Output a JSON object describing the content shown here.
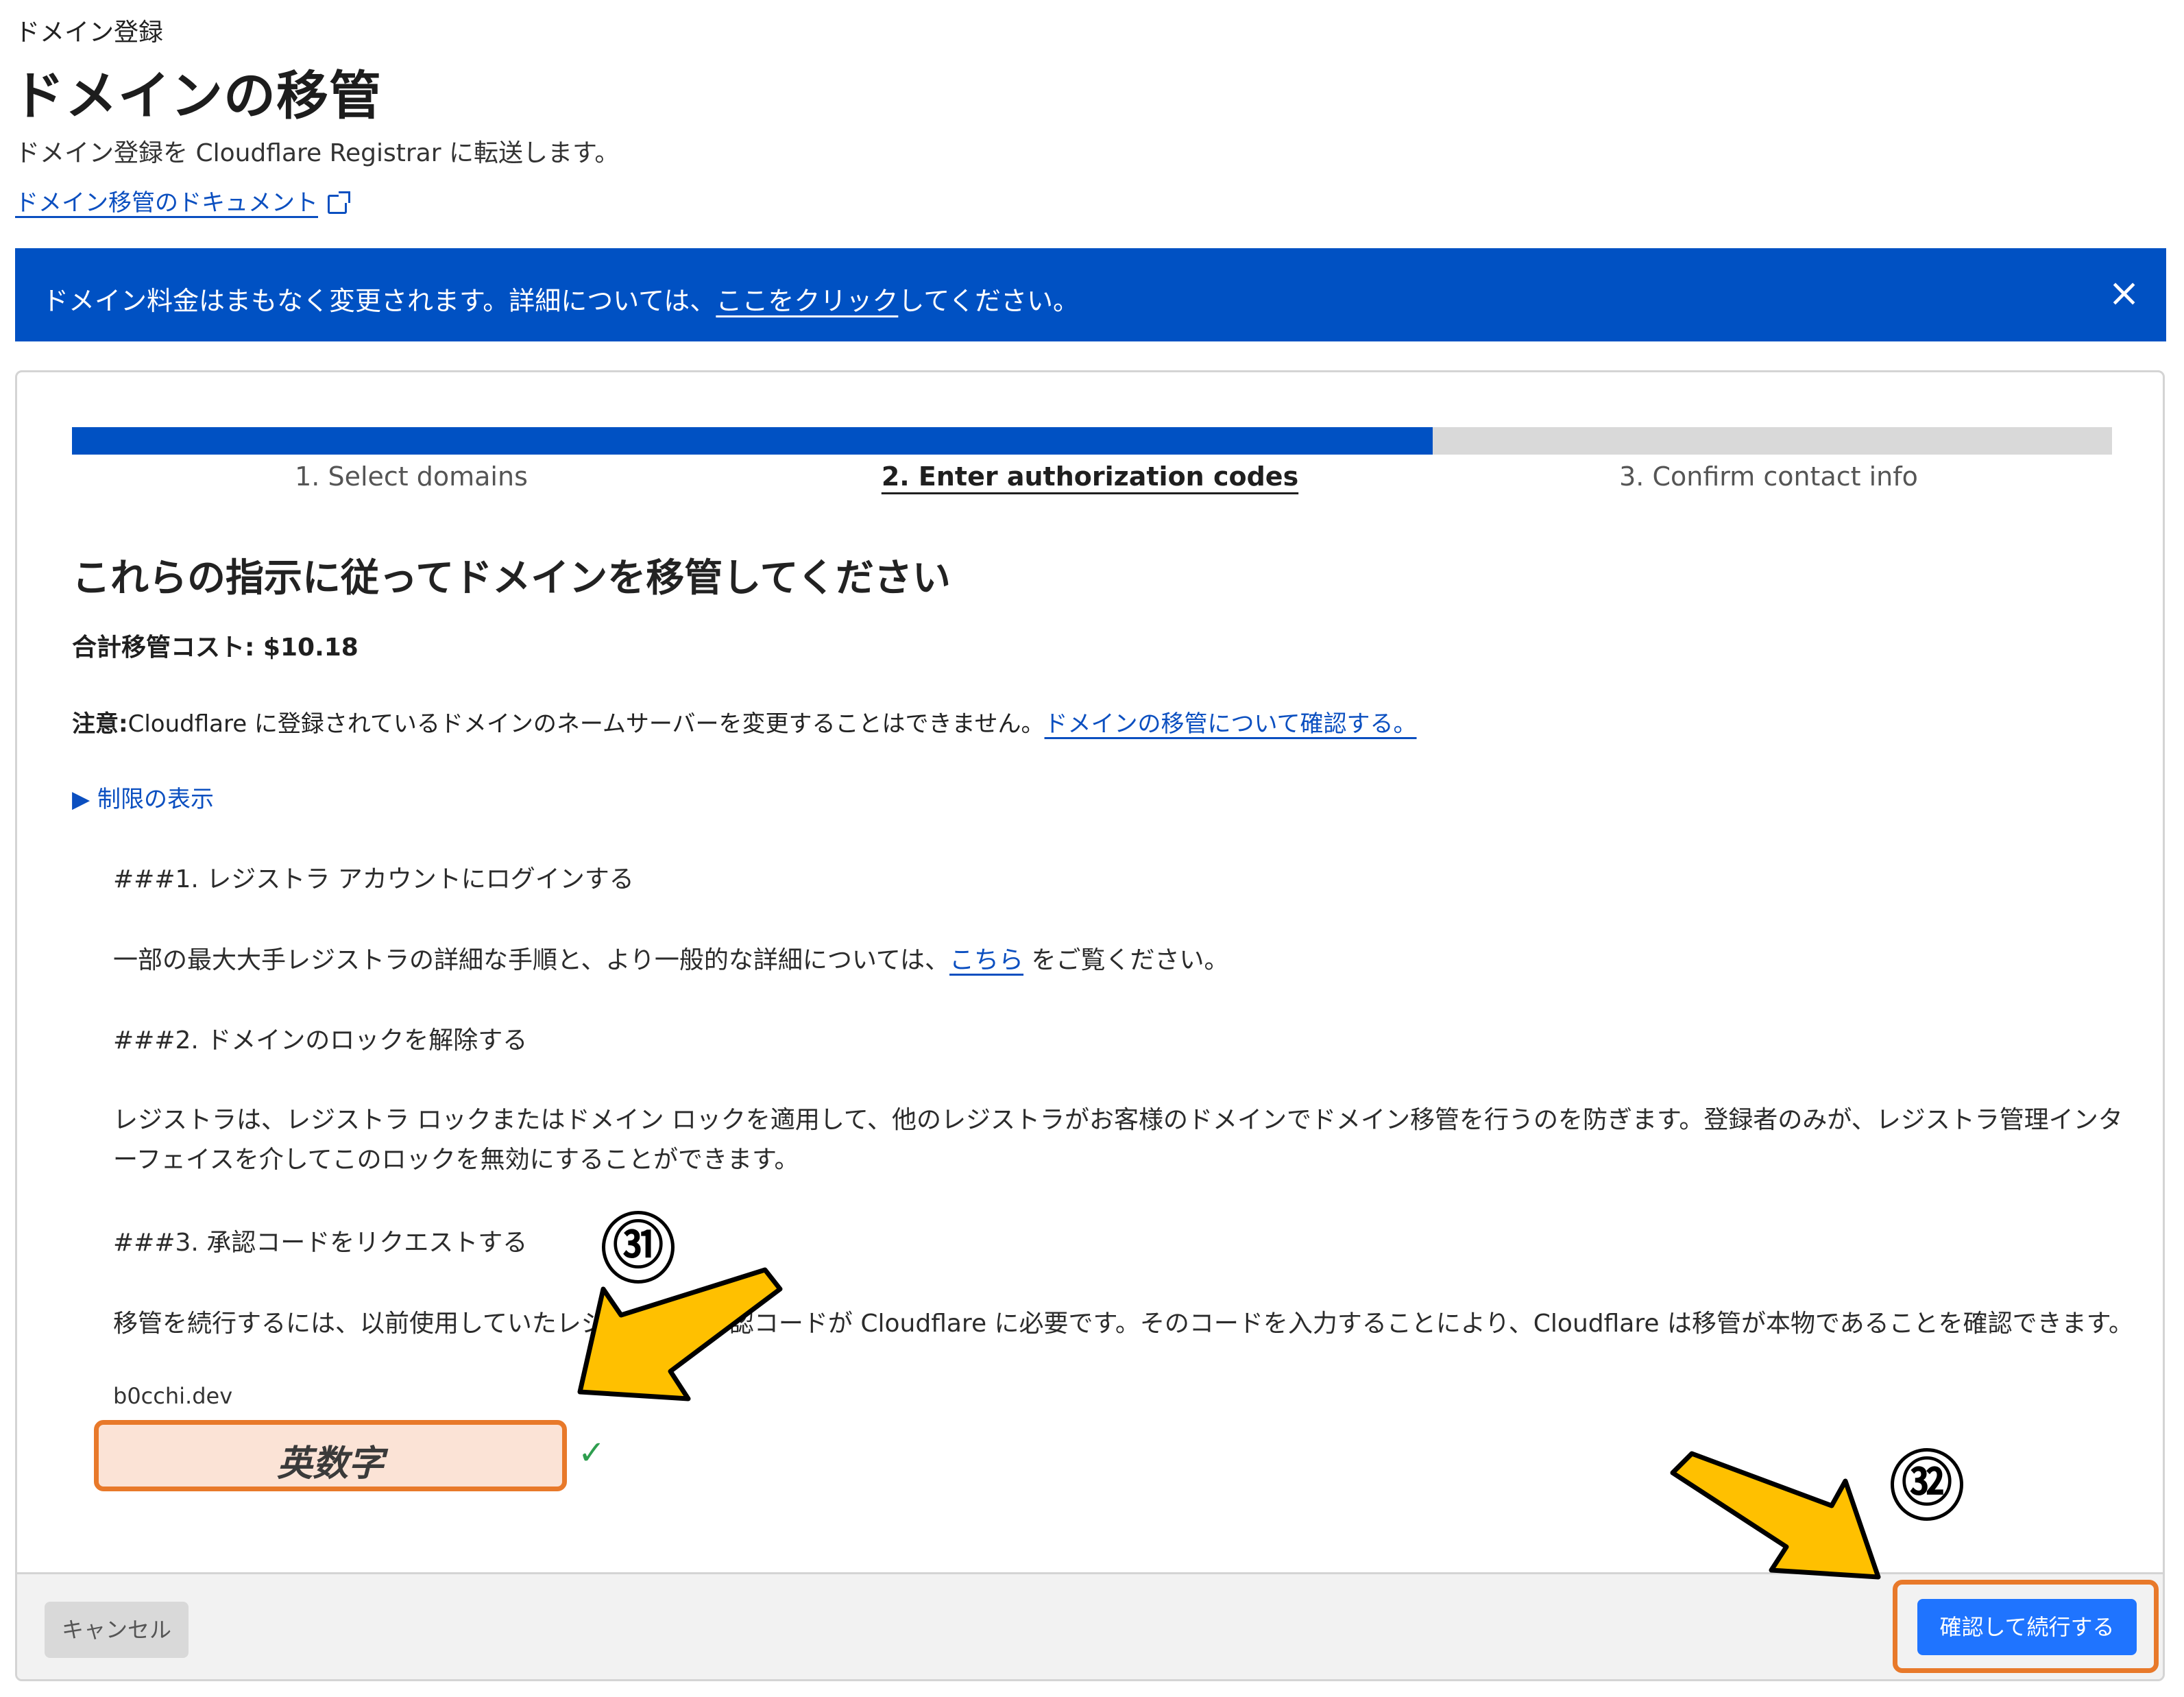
{
  "header": {
    "breadcrumb": "ドメイン登録",
    "title": "ドメインの移管",
    "description": "ドメイン登録を Cloudflare Registrar に転送します。",
    "docs_link": "ドメイン移管のドキュメント"
  },
  "banner": {
    "text_before": "ドメイン料金はまもなく変更されます。詳細については、",
    "link": "ここをクリック",
    "text_after": "してください。",
    "close": "×"
  },
  "progress": {
    "value": 0.667,
    "steps": [
      {
        "label": "1. Select domains"
      },
      {
        "label": "2. Enter authorization codes"
      },
      {
        "label": "3. Confirm contact info"
      }
    ]
  },
  "content": {
    "heading": "これらの指示に従ってドメインを移管してください",
    "total_cost": "合計移管コスト: $10.18",
    "note_label": "注意:",
    "note_text": "Cloudflare に登録されているドメインのネームサーバーを変更することはできません。",
    "note_link": "ドメインの移管について確認する。",
    "limits_toggle": "▶ 制限の表示",
    "step1_heading": "###1.  レジストラ アカウントにログインする",
    "step1_before": "一部の最大大手レジストラの詳細な手順と、より一般的な詳細については、",
    "step1_link": "こちら",
    "step1_after": " をご覧ください。",
    "step2_heading": "###2.  ドメインのロックを解除する",
    "step2_text": "レジストラは、レジストラ ロックまたはドメイン ロックを適用して、他のレジストラがお客様のドメインでドメイン移管を行うのを防ぎます。登録者のみが、レジストラ管理インターフェイスを介してこのロックを無効にすることができます。",
    "step3_heading": "###3.  承認コードをリクエストする",
    "step3_text": "移管を続行するには、以前使用していたレジストラの承認コードが Cloudflare に必要です。そのコードを入力することにより、Cloudflare は移管が本物であることを確認できます。",
    "domain": "b0cchi.dev",
    "auth_input_value": "英数字",
    "check": "✓"
  },
  "footer": {
    "cancel": "キャンセル",
    "confirm": "確認して続行する"
  },
  "annotations": {
    "badge_31": "㉛",
    "badge_32": "㉜",
    "arrow_color": "#ffc000",
    "highlight_color": "#e8792a"
  }
}
